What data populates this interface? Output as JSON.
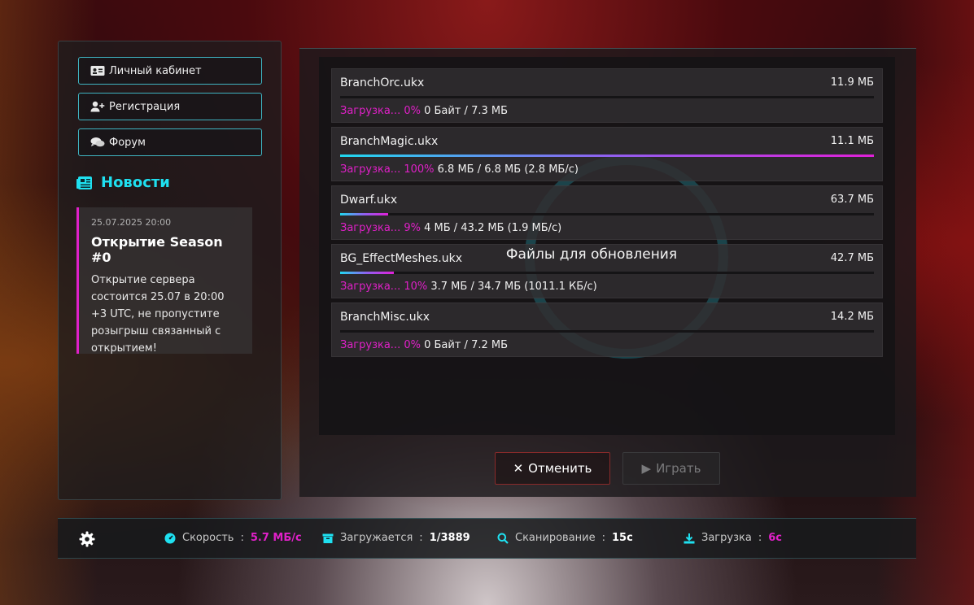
{
  "sidebar": {
    "nav": [
      {
        "label": "Личный кабинет",
        "icon": "id-card-icon"
      },
      {
        "label": "Регистрация",
        "icon": "user-plus-icon"
      },
      {
        "label": "Форум",
        "icon": "comments-icon"
      }
    ],
    "news_heading": "Новости",
    "news": {
      "date": "25.07.2025 20:00",
      "title": "Открытие Season #0",
      "body": "Открытие сервера состоится 25.07 в 20:00 +3 UTC, не пропустите розыгрыш связанный с открытием!"
    }
  },
  "files": [
    {
      "name": "BranchOrc.ukx",
      "size": "11.9 МБ",
      "status_label": "Загрузка... 0%",
      "status_detail": "0 Байт / 7.3 МБ",
      "progress": 0
    },
    {
      "name": "BranchMagic.ukx",
      "size": "11.1 МБ",
      "status_label": "Загрузка... 100%",
      "status_detail": "6.8 МБ / 6.8 МБ (2.8 МБ/с)",
      "progress": 100
    },
    {
      "name": "Dwarf.ukx",
      "size": "63.7 МБ",
      "status_label": "Загрузка... 9%",
      "status_detail": "4 МБ / 43.2 МБ (1.9 МБ/с)",
      "progress": 9
    },
    {
      "name": "BG_EffectMeshes.ukx",
      "size": "42.7 МБ",
      "status_label": "Загрузка... 10%",
      "status_detail": "3.7 МБ / 34.7 МБ (1011.1 КБ/с)",
      "progress": 10
    },
    {
      "name": "BranchMisc.ukx",
      "size": "14.2 МБ",
      "status_label": "Загрузка... 0%",
      "status_detail": "0 Байт / 7.2 МБ",
      "progress": 0
    }
  ],
  "overlay_text": "Файлы для обновления",
  "buttons": {
    "cancel": "Отменить",
    "play": "Играть"
  },
  "statusbar": {
    "speed_label": "Скорость",
    "speed_value": "5.7 МБ/с",
    "loading_label": "Загружается",
    "loading_value": "1/3889",
    "scan_label": "Сканирование",
    "scan_value": "15с",
    "download_label": "Загрузка",
    "download_value": "6с"
  },
  "colors": {
    "accent_cyan": "#1fe0f0",
    "accent_pink": "#e020c8"
  }
}
